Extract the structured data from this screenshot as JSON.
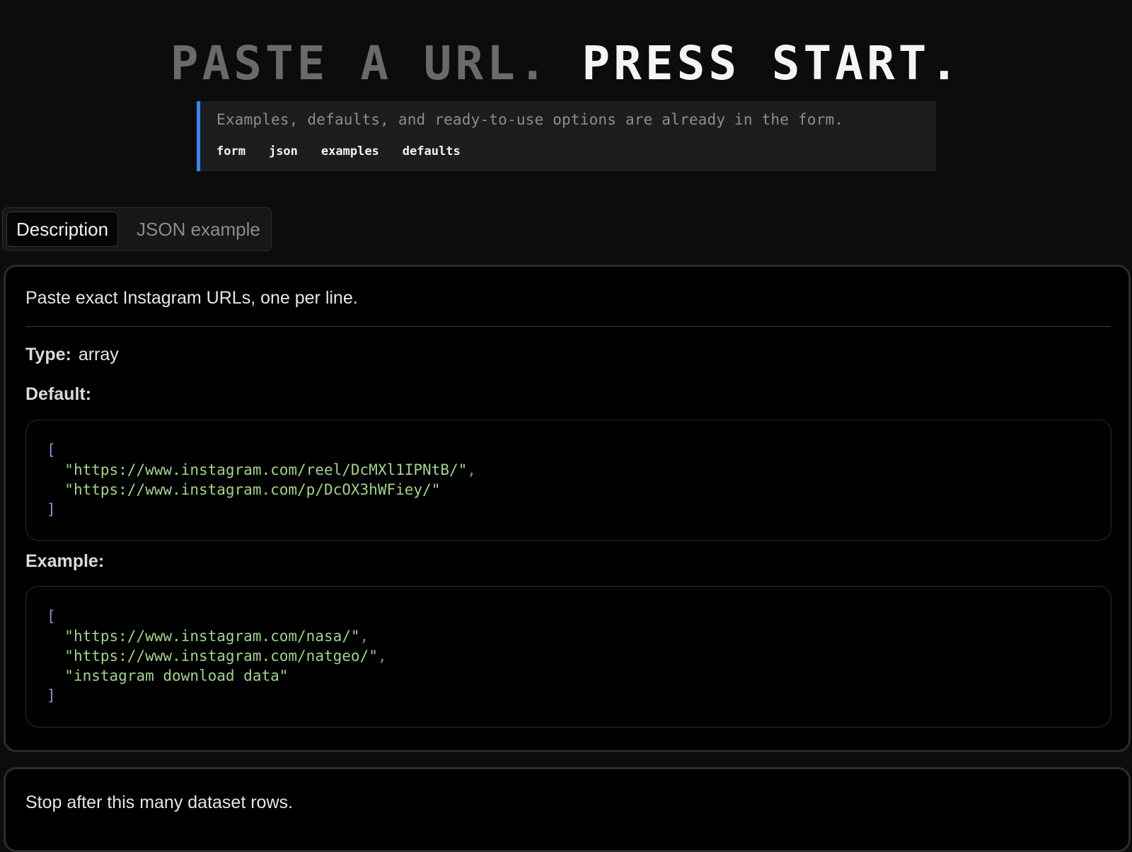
{
  "hero": {
    "title_dim": "PASTE A URL.",
    "title_bright": "PRESS START.",
    "note": "Examples, defaults, and ready-to-use options are already in the form.",
    "tags": [
      "form",
      "json",
      "examples",
      "defaults"
    ]
  },
  "tabs": {
    "description": "Description",
    "json_example": "JSON example",
    "active": "Description"
  },
  "field": {
    "description": "Paste exact Instagram URLs, one per line.",
    "type_label": "Type:",
    "type_value": "array",
    "default_label": "Default:",
    "default_values": [
      "https://www.instagram.com/reel/DcMXl1IPNtB/",
      "https://www.instagram.com/p/DcOX3hWFiey/"
    ],
    "example_label": "Example:",
    "example_values": [
      "https://www.instagram.com/nasa/",
      "https://www.instagram.com/natgeo/",
      "instagram download data"
    ]
  },
  "next_field": {
    "description": "Stop after this many dataset rows."
  },
  "colors": {
    "accent": "#3e82f0",
    "bracket": "#a784d6",
    "string": "#a3d28f"
  }
}
